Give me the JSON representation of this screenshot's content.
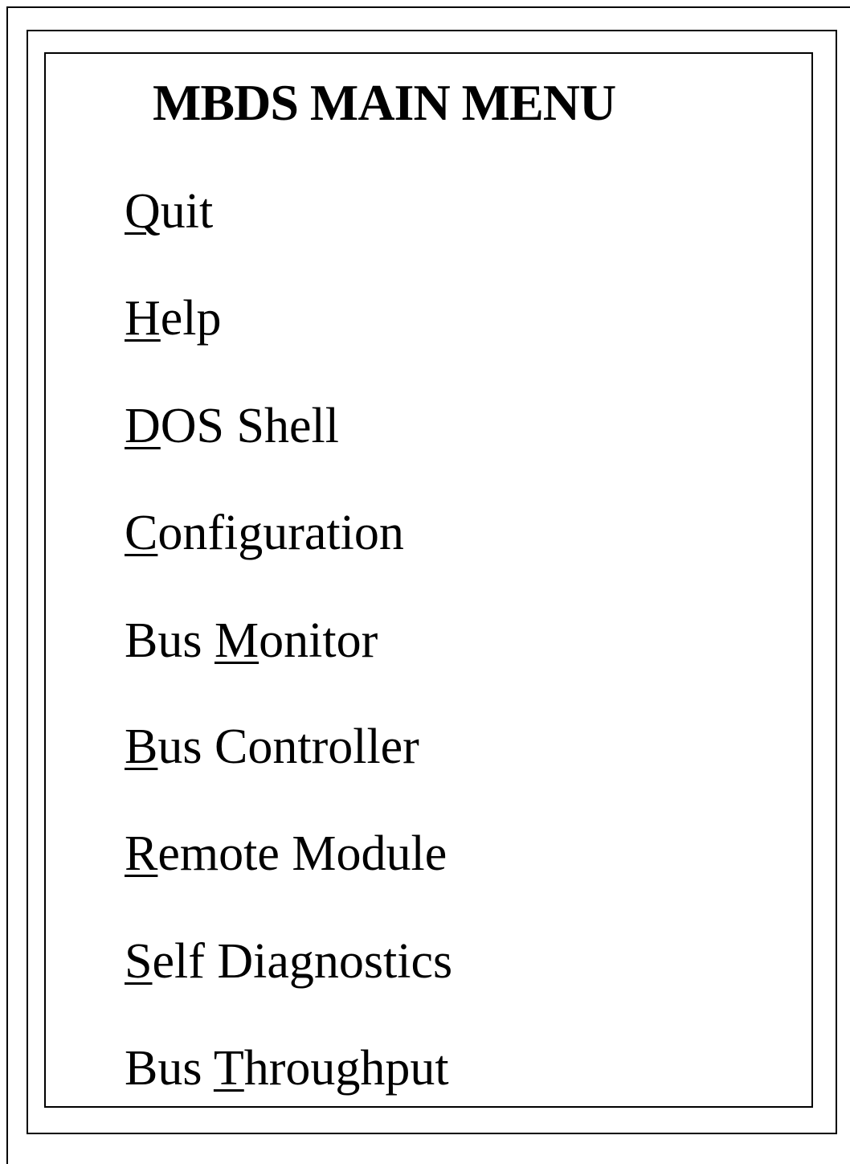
{
  "menu": {
    "title": "MBDS MAIN MENU",
    "items": [
      {
        "before": "",
        "hotkey": "Q",
        "after": "uit"
      },
      {
        "before": "",
        "hotkey": "H",
        "after": "elp"
      },
      {
        "before": "",
        "hotkey": "D",
        "after": "OS Shell"
      },
      {
        "before": "",
        "hotkey": "C",
        "after": "onfiguration"
      },
      {
        "before": "Bus ",
        "hotkey": "M",
        "after": "onitor"
      },
      {
        "before": "",
        "hotkey": "B",
        "after": "us Controller"
      },
      {
        "before": "",
        "hotkey": "R",
        "after": "emote Module"
      },
      {
        "before": "",
        "hotkey": "S",
        "after": "elf Diagnostics"
      },
      {
        "before": "Bus ",
        "hotkey": "T",
        "after": "hroughput"
      }
    ]
  }
}
